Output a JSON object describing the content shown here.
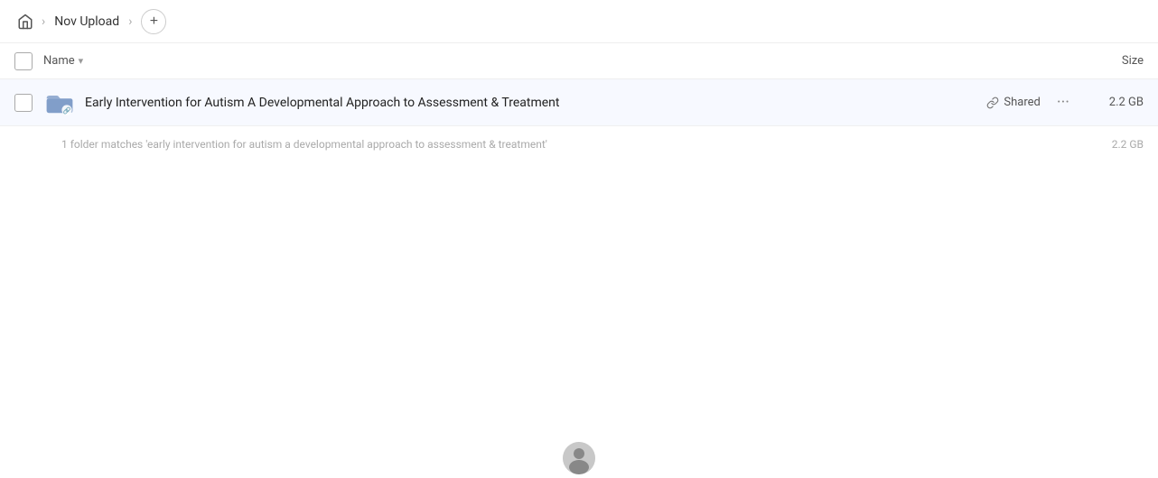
{
  "header": {
    "home_label": "Home",
    "breadcrumb": [
      {
        "label": "Nov Upload"
      }
    ],
    "add_button_label": "+"
  },
  "columns": {
    "name_label": "Name",
    "size_label": "Size"
  },
  "file_row": {
    "name": "Early Intervention for Autism A Developmental Approach to Assessment & Treatment",
    "shared_label": "Shared",
    "size": "2.2 GB"
  },
  "summary": {
    "text": "1 folder matches 'early intervention for autism a developmental approach to assessment & treatment'",
    "size": "2.2 GB"
  },
  "icons": {
    "home": "⌂",
    "chevron_right": "›",
    "chevron_down": "▾",
    "link": "🔗",
    "more": "···"
  }
}
